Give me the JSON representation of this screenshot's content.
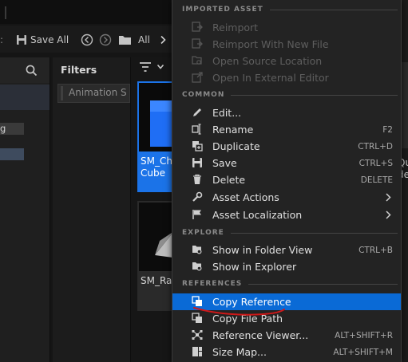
{
  "toolbar": {
    "save_all_label": "Save All",
    "all_label": "All"
  },
  "left_panel": {
    "item_suffix": "g"
  },
  "filters": {
    "title": "Filters",
    "chip_label": "Animation S"
  },
  "assets": [
    {
      "label": "SM_Cha Cube",
      "label_line1": "SM_Cha",
      "label_line2": "Cube",
      "selected": true
    },
    {
      "label": "SM_Ram",
      "label_line1": "SM_Ram",
      "label_line2": "",
      "selected": false
    }
  ],
  "right_peek": {
    "line1": "Qu",
    "line2": "de"
  },
  "menu": {
    "sections": {
      "imported_asset": "IMPORTED ASSET",
      "common": "COMMON",
      "explore": "EXPLORE",
      "references": "REFERENCES"
    },
    "items": {
      "reimport": {
        "label": "Reimport",
        "icon": "reimport-icon",
        "enabled": false
      },
      "reimport_new": {
        "label": "Reimport With New File",
        "icon": "reimport-icon",
        "enabled": false
      },
      "open_source": {
        "label": "Open Source Location",
        "icon": "folder-search-icon",
        "enabled": false
      },
      "open_external": {
        "label": "Open In External Editor",
        "icon": "external-editor-icon",
        "enabled": false
      },
      "edit": {
        "label": "Edit...",
        "icon": "pencil-icon"
      },
      "rename": {
        "label": "Rename",
        "icon": "rename-icon",
        "shortcut": "F2"
      },
      "duplicate": {
        "label": "Duplicate",
        "icon": "duplicate-icon",
        "shortcut": "CTRL+D"
      },
      "save": {
        "label": "Save",
        "icon": "save-icon",
        "shortcut": "CTRL+S"
      },
      "delete": {
        "label": "Delete",
        "icon": "trash-icon",
        "shortcut": "DELETE"
      },
      "asset_actions": {
        "label": "Asset Actions",
        "icon": "wrench-icon"
      },
      "asset_localization": {
        "label": "Asset Localization",
        "icon": "flag-icon"
      },
      "show_folder": {
        "label": "Show in Folder View",
        "icon": "folder-search-icon",
        "shortcut": "CTRL+B"
      },
      "show_explorer": {
        "label": "Show in Explorer",
        "icon": "folder-search-icon"
      },
      "copy_reference": {
        "label": "Copy Reference",
        "icon": "copy-icon",
        "highlighted": true
      },
      "copy_file_path": {
        "label": "Copy File Path",
        "icon": "copy-icon"
      },
      "reference_viewer": {
        "label": "Reference Viewer...",
        "icon": "reference-viewer-icon",
        "shortcut": "ALT+SHIFT+R"
      },
      "size_map": {
        "label": "Size Map...",
        "icon": "size-map-icon",
        "shortcut": "ALT+SHIFT+M"
      }
    }
  },
  "colors": {
    "highlight": "#0a6ad6",
    "annotation_stroke": "#d01818",
    "asset_selected": "#1b73e8",
    "cube": "#1f6ef5"
  }
}
